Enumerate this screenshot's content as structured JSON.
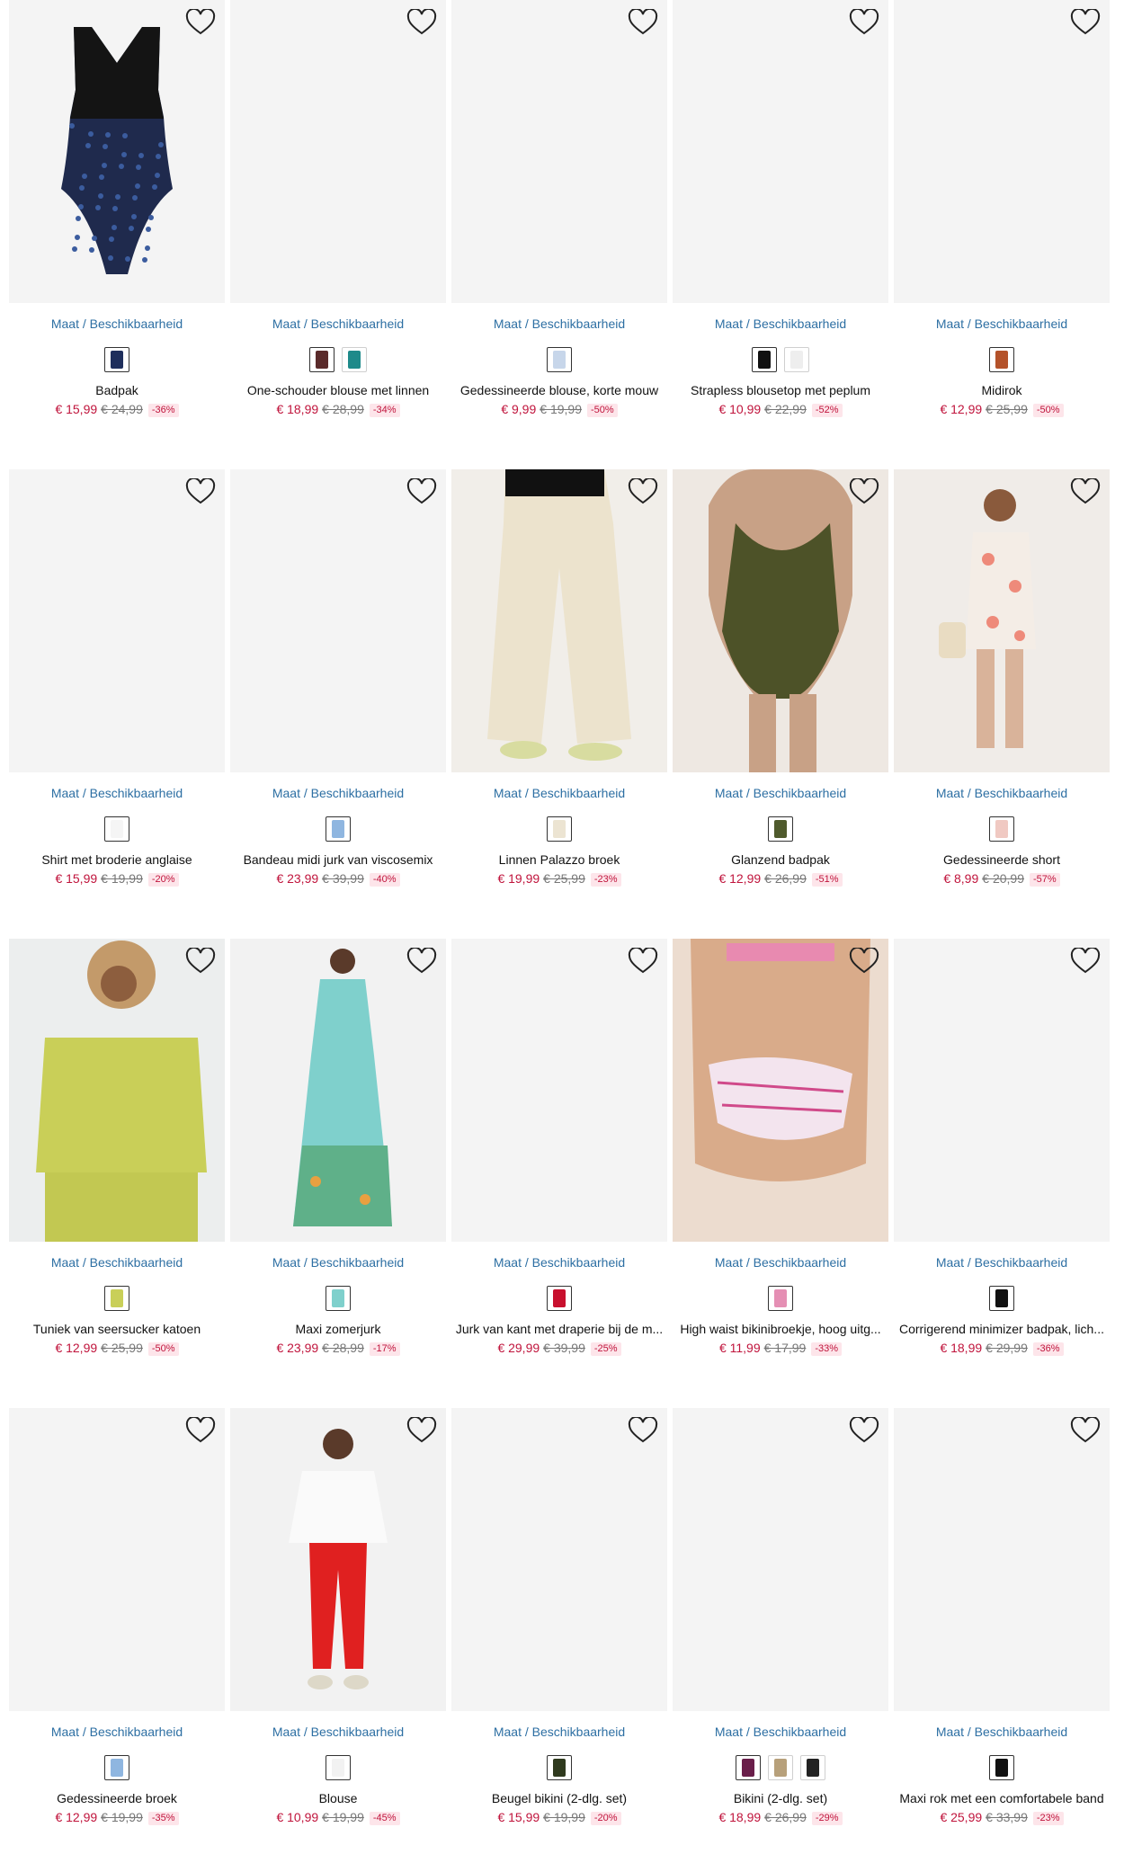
{
  "accent_colors": {
    "link": "#2d6fa3",
    "price": "#c0143c",
    "discount_bg": "#fde5ea",
    "image_placeholder": "#f4f4f4"
  },
  "labels": {
    "size_link": "Maat / Beschikbaarheid",
    "favorite_icon": "heart-outline-icon"
  },
  "products": [
    {
      "name": "Badpak",
      "price": "€ 15,99",
      "old_price": "€ 24,99",
      "discount": "-36%",
      "image": "swimsuit-black-leopard",
      "swatches": [
        "#1e2e5c"
      ]
    },
    {
      "name": "One-schouder blouse met linnen",
      "price": "€ 18,99",
      "old_price": "€ 28,99",
      "discount": "-34%",
      "image": "",
      "swatches": [
        "#5a2a2a",
        "#1e8a8a"
      ]
    },
    {
      "name": "Gedessineerde blouse, korte mouw",
      "price": "€ 9,99",
      "old_price": "€ 19,99",
      "discount": "-50%",
      "image": "",
      "swatches": [
        "#c7d6ea"
      ]
    },
    {
      "name": "Strapless blousetop met peplum",
      "price": "€ 10,99",
      "old_price": "€ 22,99",
      "discount": "-52%",
      "image": "",
      "swatches": [
        "#111111",
        "#eeeeee"
      ]
    },
    {
      "name": "Midirok",
      "price": "€ 12,99",
      "old_price": "€ 25,99",
      "discount": "-50%",
      "image": "",
      "swatches": [
        "#b4522a"
      ]
    },
    {
      "name": "Shirt met broderie anglaise",
      "price": "€ 15,99",
      "old_price": "€ 19,99",
      "discount": "-20%",
      "image": "",
      "swatches": [
        "#f5f5f5"
      ]
    },
    {
      "name": "Bandeau midi jurk van viscosemix",
      "price": "€ 23,99",
      "old_price": "€ 39,99",
      "discount": "-40%",
      "image": "",
      "swatches": [
        "#8fb6e0"
      ]
    },
    {
      "name": "Linnen Palazzo broek",
      "price": "€ 19,99",
      "old_price": "€ 25,99",
      "discount": "-23%",
      "image": "wide-leg-cream-trousers",
      "swatches": [
        "#ece4d2"
      ]
    },
    {
      "name": "Glanzend badpak",
      "price": "€ 12,99",
      "old_price": "€ 26,99",
      "discount": "-51%",
      "image": "olive-swimsuit-back",
      "swatches": [
        "#4f5a2c"
      ]
    },
    {
      "name": "Gedessineerde short",
      "price": "€ 8,99",
      "old_price": "€ 20,99",
      "discount": "-57%",
      "image": "floral-shorts-set",
      "swatches": [
        "#f0c9c2"
      ]
    },
    {
      "name": "Tuniek van seersucker katoen",
      "price": "€ 12,99",
      "old_price": "€ 25,99",
      "discount": "-50%",
      "image": "lime-seersucker-tunic",
      "swatches": [
        "#c9cf58"
      ]
    },
    {
      "name": "Maxi zomerjurk",
      "price": "€ 23,99",
      "old_price": "€ 28,99",
      "discount": "-17%",
      "image": "turquoise-maxi-dress",
      "swatches": [
        "#7fd0cc"
      ]
    },
    {
      "name": "Jurk van kant met draperie bij de m...",
      "price": "€ 29,99",
      "old_price": "€ 39,99",
      "discount": "-25%",
      "image": "",
      "swatches": [
        "#c8102e"
      ]
    },
    {
      "name": "High waist bikinibroekje, hoog uitg...",
      "price": "€ 11,99",
      "old_price": "€ 17,99",
      "discount": "-33%",
      "image": "printed-bikini-bottom",
      "swatches": [
        "#e58fb4"
      ]
    },
    {
      "name": "Corrigerend minimizer badpak, lich...",
      "price": "€ 18,99",
      "old_price": "€ 29,99",
      "discount": "-36%",
      "image": "",
      "swatches": [
        "#111111"
      ]
    },
    {
      "name": "Gedessineerde broek",
      "price": "€ 12,99",
      "old_price": "€ 19,99",
      "discount": "-35%",
      "image": "",
      "swatches": [
        "#8fb6e0"
      ]
    },
    {
      "name": "Blouse",
      "price": "€ 10,99",
      "old_price": "€ 19,99",
      "discount": "-45%",
      "image": "white-blouse-red-pants",
      "swatches": [
        "#f2f2f2"
      ]
    },
    {
      "name": "Beugel bikini (2-dlg. set)",
      "price": "€ 15,99",
      "old_price": "€ 19,99",
      "discount": "-20%",
      "image": "",
      "swatches": [
        "#2f3a1e"
      ]
    },
    {
      "name": "Bikini (2-dlg. set)",
      "price": "€ 18,99",
      "old_price": "€ 26,99",
      "discount": "-29%",
      "image": "",
      "swatches": [
        "#6a1e4a",
        "#b7a07a",
        "#222222"
      ]
    },
    {
      "name": "Maxi rok met een comfortabele band",
      "price": "€ 25,99",
      "old_price": "€ 33,99",
      "discount": "-23%",
      "image": "",
      "swatches": [
        "#111111"
      ]
    }
  ]
}
